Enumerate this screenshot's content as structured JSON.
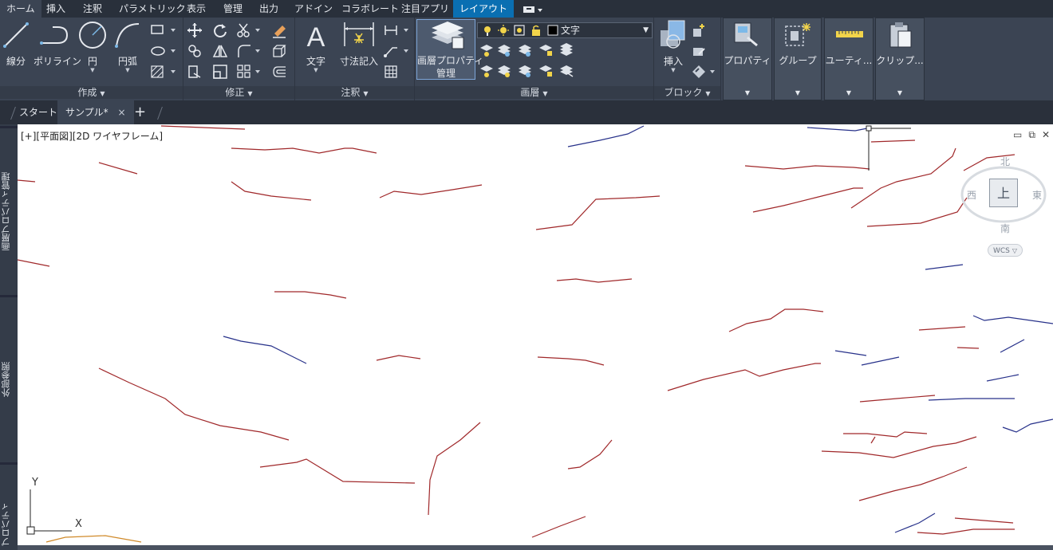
{
  "menu_tabs": [
    "ホーム",
    "挿入",
    "注釈",
    "パラメトリック",
    "表示",
    "管理",
    "出力",
    "アドイン",
    "コラボレート",
    "注目アプリ",
    "レイアウト"
  ],
  "menu_extra_icon": "quick-access-toggle-icon",
  "ribbon": {
    "draw": {
      "title": "作成",
      "line": "線分",
      "polyline": "ポリライン",
      "circle": "円",
      "arc": "円弧"
    },
    "modify": {
      "title": "修正"
    },
    "annotation": {
      "title": "注釈",
      "text": "文字",
      "dimension": "寸法記入"
    },
    "layers": {
      "title": "画層",
      "properties_line1": "画層プロパティ",
      "properties_line2": "管理",
      "current_layer": "文字"
    },
    "block": {
      "title": "ブロック",
      "insert": "挿入"
    },
    "properties": "プロパティ",
    "groups": "グループ",
    "utilities": "ユーティ...",
    "clipboard": "クリップ..."
  },
  "file_tabs": {
    "start": "スタート",
    "active": "サンプル*",
    "close": "×",
    "new": "+"
  },
  "viewport": {
    "control": "[+][平面図][2D ワイヤフレーム]"
  },
  "viewcube": {
    "north": "北",
    "south": "南",
    "east": "東",
    "west": "西",
    "top": "上",
    "wcs": "WCS"
  },
  "ucs": {
    "x": "X",
    "y": "Y"
  },
  "palettes": {
    "layer_properties": "画層プロパティ管理",
    "external_refs": "外部参照",
    "properties": "プロパティ"
  },
  "colors": {
    "ribbon_bg": "#3b4453",
    "active_tab": "#0a6fb2",
    "drawing_bg": "#ffffff",
    "line_red": "#a0282a",
    "line_blue": "#27318a",
    "line_orange": "#d08a2a"
  }
}
